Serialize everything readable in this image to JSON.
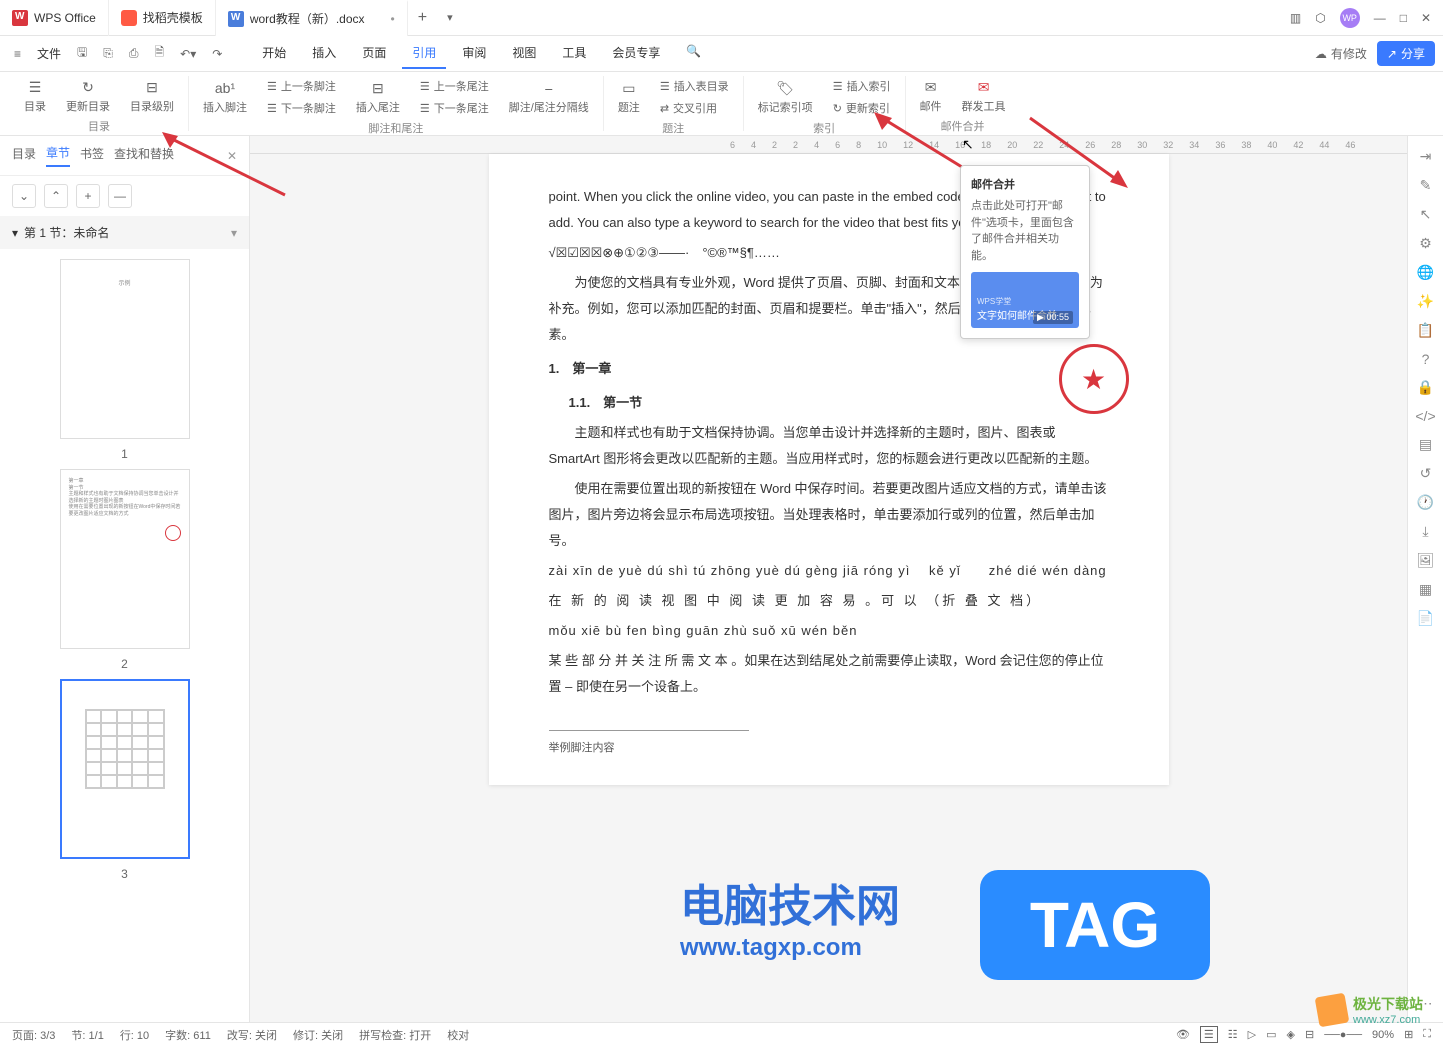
{
  "titlebar": {
    "app_name": "WPS Office",
    "template_tab": "找稻壳模板",
    "doc_tab": "word教程（新）.docx",
    "doc_dirty": "•"
  },
  "menubar": {
    "file": "文件",
    "tabs": {
      "start": "开始",
      "insert": "插入",
      "page": "页面",
      "cite": "引用",
      "review": "审阅",
      "view": "视图",
      "tools": "工具",
      "member": "会员专享"
    },
    "has_changes": "有修改",
    "share": "分享"
  },
  "ribbon": {
    "toc": "目录",
    "update_toc": "更新目录",
    "toc_level": "目录级别",
    "toc_group": "目录",
    "insert_footnote": "插入脚注",
    "prev_footnote": "上一条脚注",
    "next_footnote": "下一条脚注",
    "insert_endnote": "插入尾注",
    "prev_endnote": "上一条尾注",
    "next_endnote": "下一条尾注",
    "separator": "脚注/尾注分隔线",
    "footnote_group": "脚注和尾注",
    "caption": "题注",
    "insert_fig_toc": "插入表目录",
    "cross_ref": "交叉引用",
    "caption_group": "题注",
    "mark_index": "标记索引项",
    "insert_index": "插入索引",
    "update_index": "更新索引",
    "index_group": "索引",
    "mail": "邮件",
    "mass_tool": "群发工具",
    "mail_group": "邮件合并"
  },
  "sidebar": {
    "tabs": {
      "toc": "目录",
      "chapters": "章节",
      "bookmarks": "书签",
      "find_replace": "查找和替换"
    },
    "section_title": "第 1 节：未命名",
    "thumbs": [
      "1",
      "2",
      "3"
    ]
  },
  "ruler": [
    "6",
    "4",
    "2",
    "2",
    "4",
    "6",
    "8",
    "10",
    "12",
    "14",
    "16",
    "18",
    "20",
    "22",
    "24",
    "26",
    "28",
    "30",
    "32",
    "34",
    "36",
    "38",
    "40",
    "42",
    "44",
    "46"
  ],
  "doc": {
    "p1": "point. When you click the online video, you can paste in the embed code of the video you want to add. You can also type a keyword to search for the video that best fits your document.）",
    "symbols": "√☒☑☒☒⊗⊕①②③——·　°©®™§¶……",
    "p2": "　　为使您的文档具有专业外观，Word 提供了页眉、页脚、封面和文本框设计，这些设计可互为补充。例如，您可以添加匹配的封面、页眉和提要栏。单击\"插入\"，然后从不同库中选择所需元素。",
    "h1": "1.　第一章",
    "h2": "1.1.　第一节",
    "p3": "　　主题和样式也有助于文档保持协调。当您单击设计并选择新的主题时，图片、图表或 SmartArt 图形将会更改以匹配新的主题。当应用样式时，您的标题会进行更改以匹配新的主题。",
    "p4": "　　使用在需要位置出现的新按钮在 Word 中保存时间。若要更改图片适应文档的方式，请单击该图片，图片旁边将会显示布局选项按钮。当处理表格时，单击要添加行或列的位置，然后单击加号。",
    "pinyin1": "zài xīn de yuè dú shì tú zhōng yuè dú gèng jiā róng yì 　kě yǐ　　zhé dié wén dàng",
    "p5": "在 新 的 阅 读 视 图 中 阅 读 更 加 容 易 。可 以 （折 叠 文 档）",
    "pinyin2": "mǒu xiē bù fen bìng guān zhù suǒ xū wén běn",
    "p6": "某 些 部 分 并 关 注 所 需 文 本 。如果在达到结尾处之前需要停止读取，Word 会记住您的停止位置 – 即使在另一个设备上。",
    "footnote": "举例脚注内容"
  },
  "tooltip": {
    "title": "邮件合并",
    "desc": "点击此处可打开\"邮件\"选项卡，里面包含了邮件合并相关功能。",
    "video_label": "文字如何邮件合并",
    "video_tag": "WPS学堂",
    "video_time": "00:55"
  },
  "statusbar": {
    "page": "页面: 3/3",
    "section": "节: 1/1",
    "line": "行: 10",
    "words": "字数: 611",
    "track": "改写: 关闭",
    "revision": "修订: 关闭",
    "spell": "拼写检查: 打开",
    "proof": "校对",
    "zoom": "90%"
  },
  "watermarks": {
    "wm1_title": "电脑技术网",
    "wm1_sub": "www.tagxp.com",
    "wm2": "TAG",
    "wm3_text": "极光下载站",
    "wm3_url": "www.xz7.com"
  }
}
